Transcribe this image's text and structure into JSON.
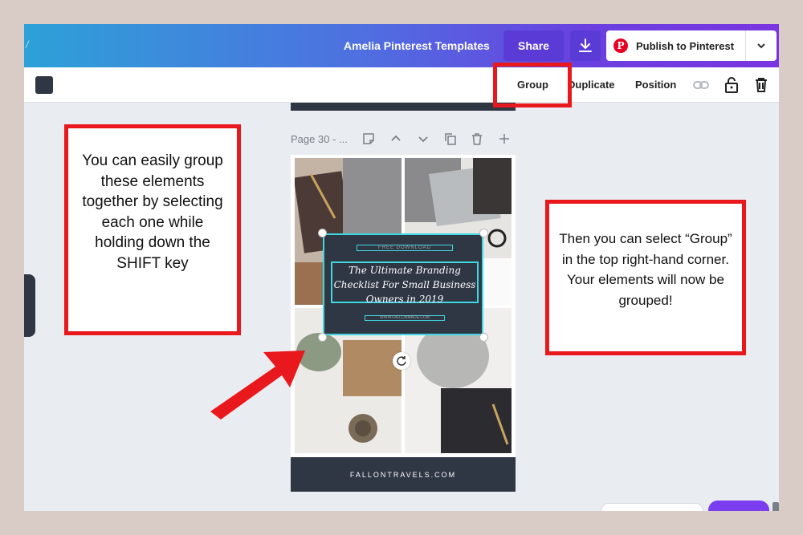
{
  "header": {
    "doc_title": "Amelia Pinterest Templates",
    "share_label": "Share",
    "publish_label": "Publish to Pinterest",
    "pinterest_letter": "P"
  },
  "toolbar": {
    "group_label": "Group",
    "duplicate_label": "Duplicate",
    "position_label": "Position"
  },
  "page": {
    "label": "Page 30 - ...",
    "free_download": "FREE DOWNLOAD",
    "title": "The Ultimate Branding Checklist For Small Business Owners in 2019",
    "url": "WWW.FALLONMADE.COM",
    "footer": "FALLONTRAVELS.COM"
  },
  "callouts": {
    "left": "You can easily group these elements together by selecting each one while holding down the SHIFT key",
    "right": "Then you can select “Group” in the top right-hand corner. Your elements will now be grouped!"
  },
  "colors": {
    "annotation_red": "#e8181c",
    "selection_cyan": "#3fd7e0",
    "dark_navy": "#2f3644",
    "canva_purple": "#5a3bd6"
  }
}
